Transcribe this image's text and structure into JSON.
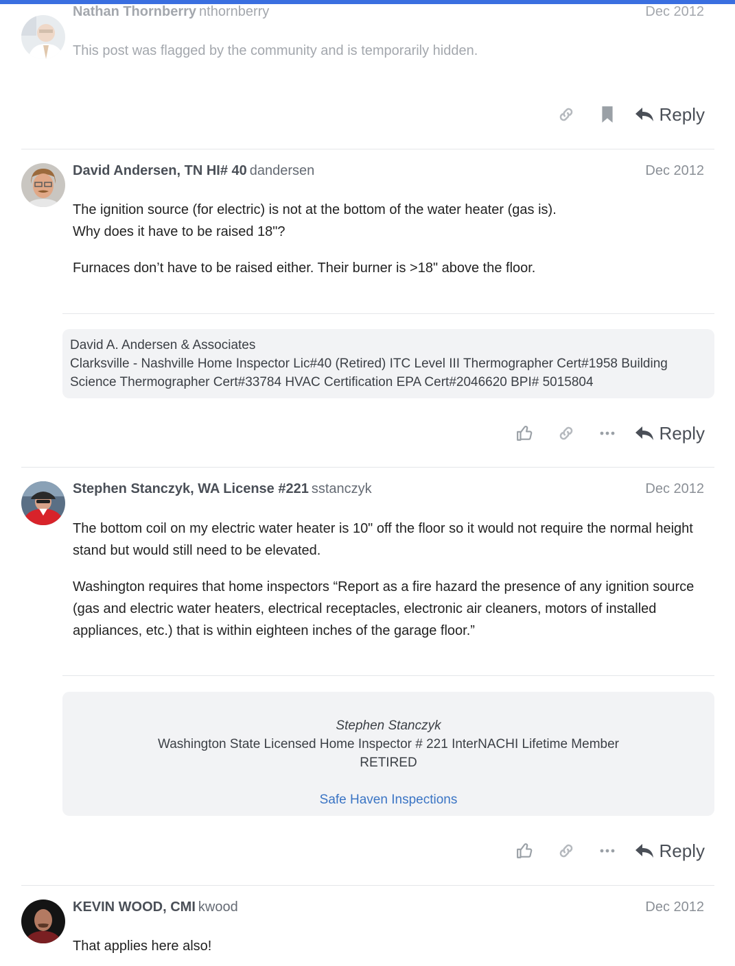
{
  "posts": [
    {
      "fullname": "Nathan Thornberry",
      "username": "nthornberry",
      "date": "Dec 2012",
      "body": "This post was flagged by the community and is temporarily hidden.",
      "reply_label": "Reply"
    },
    {
      "fullname": "David Andersen, TN HI# 40",
      "username": "dandersen",
      "date": "Dec 2012",
      "body_lines": [
        "The ignition source (for electric) is not at the bottom of the water heater (gas is).",
        "Why does it have to be raised 18\"?",
        "Furnaces don’t have to be raised either. Their burner is >18\" above the floor."
      ],
      "signature": {
        "line1": "David A. Andersen & Associates",
        "line2": "Clarksville - Nashville Home Inspector Lic#40 (Retired) ITC Level III Thermographer Cert#1958 Building Science Thermographer Cert#33784 HVAC Certification EPA Cert#2046620 BPI# 5015804"
      },
      "reply_label": "Reply"
    },
    {
      "fullname": "Stephen Stanczyk, WA License #221",
      "username": "sstanczyk",
      "date": "Dec 2012",
      "body_paragraphs": [
        "The bottom coil on my electric water heater is 10\" off the floor so it would not require the normal height stand but would still need to be elevated.",
        "Washington requires that home inspectors “Report as a fire hazard the presence of any ignition source (gas and electric water heaters, electrical receptacles, electronic air cleaners, motors of installed appliances, etc.) that is within eighteen inches of the garage floor.”"
      ],
      "signature": {
        "name": "Stephen Stanczyk",
        "line1": "Washington State Licensed Home Inspector # 221 InterNACHI Lifetime Member",
        "line2": "RETIRED",
        "link": "Safe Haven Inspections"
      },
      "reply_label": "Reply"
    },
    {
      "fullname": "KEVIN WOOD, CMI",
      "username": "kwood",
      "date": "Dec 2012",
      "body": "That applies here also!"
    }
  ],
  "colors": {
    "accent": "#3a6fe0",
    "link": "#3a74c4",
    "signature_bg": "#f2f3f5",
    "icon": "#9aa0a6"
  },
  "icons": [
    "link-icon",
    "bookmark-icon",
    "reply-icon",
    "like-icon",
    "more-icon"
  ]
}
